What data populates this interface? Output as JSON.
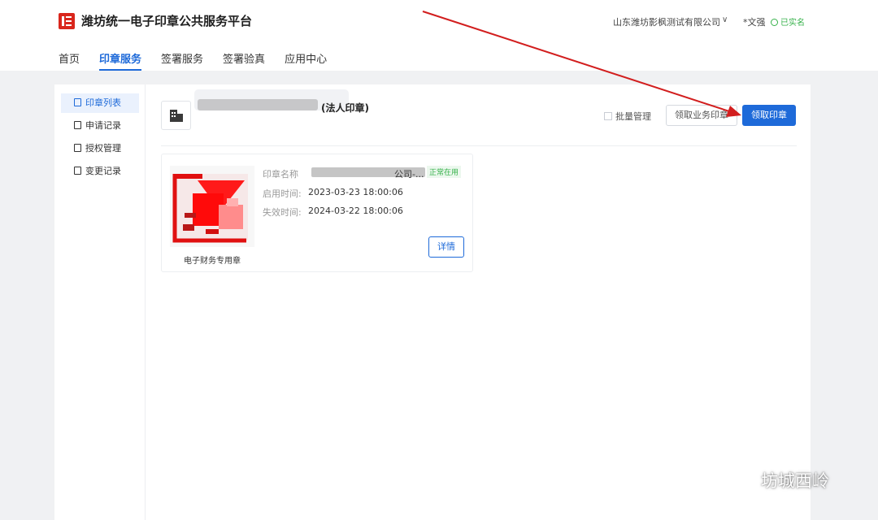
{
  "header": {
    "site_title": "潍坊统一电子印章公共服务平台",
    "company": "山东潍坊影枫测试有限公司",
    "username": "*文强",
    "verified": "已实名"
  },
  "nav": {
    "items": [
      "首页",
      "印章服务",
      "签署服务",
      "签署验真",
      "应用中心"
    ],
    "active": "印章服务"
  },
  "sidebar": {
    "items": [
      "印章列表",
      "申请记录",
      "授权管理",
      "变更记录"
    ],
    "active": "印章列表"
  },
  "content": {
    "header_title": "(法人印章)",
    "batch_label": "批量管理",
    "btn_business_seal": "领取业务印章",
    "btn_get_seal": "领取印章"
  },
  "seal_card": {
    "seal_type": "电子财务专用章",
    "name_label": "印章名称",
    "name_value": "公司-...",
    "status": "正常在用",
    "start_label": "启用时间:",
    "start_value": "2023-03-23 18:00:06",
    "expire_label": "失效时间:",
    "expire_value": "2024-03-22 18:00:06",
    "detail_button": "详情"
  },
  "watermark": {
    "text": "坊城西岭"
  },
  "colors": {
    "primary": "#1e6ad9",
    "success": "#36b14a",
    "brand_red": "#d9261c",
    "annotation_red": "#d21e1e"
  }
}
